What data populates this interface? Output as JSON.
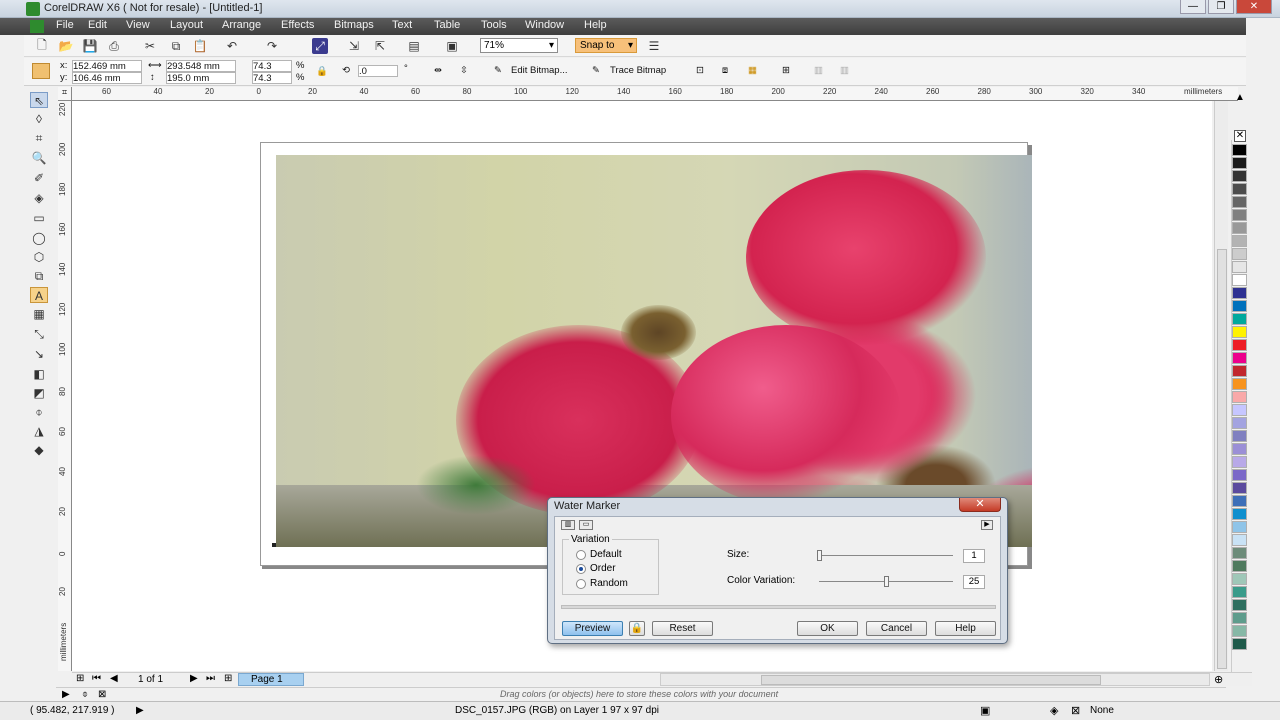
{
  "window": {
    "title": "CorelDRAW X6 ( Not for resale) - [Untitled-1]"
  },
  "menu": [
    "File",
    "Edit",
    "View",
    "Layout",
    "Arrange",
    "Effects",
    "Bitmaps",
    "Text",
    "Table",
    "Tools",
    "Window",
    "Help"
  ],
  "toolbar": {
    "zoom": "71%",
    "snap": "Snap to"
  },
  "props": {
    "x": "152.469 mm",
    "y": "106.46 mm",
    "w": "293.548 mm",
    "h": "195.0 mm",
    "sx": "74.3",
    "sy": "74.3",
    "pct": "%",
    "angle": ".0",
    "deg": "°",
    "edit_bitmap": "Edit Bitmap...",
    "trace_bitmap": "Trace Bitmap"
  },
  "ruler": {
    "top_ticks": [
      "60",
      "40",
      "20",
      "0",
      "20",
      "40",
      "60",
      "80",
      "100",
      "120",
      "140",
      "160",
      "180",
      "200",
      "220",
      "240",
      "260",
      "280",
      "300",
      "320",
      "340"
    ],
    "unit": "millimeters",
    "left_ticks": [
      "220",
      "200",
      "180",
      "160",
      "140",
      "120",
      "100",
      "80",
      "60",
      "40",
      "20",
      "0",
      "20"
    ],
    "left_unit": "millimeters"
  },
  "dialog": {
    "title": "Water Marker",
    "close": "✕",
    "variation_label": "Variation",
    "options": [
      "Default",
      "Order",
      "Random"
    ],
    "selected": "Order",
    "size_label": "Size:",
    "size_value": "1",
    "size_level": 0,
    "cv_label": "Color Variation:",
    "cv_value": "25",
    "cv_level": 0.5,
    "preview": "Preview",
    "reset": "Reset",
    "ok": "OK",
    "cancel": "Cancel",
    "help": "Help"
  },
  "pagebar": {
    "page_count": "1 of 1",
    "page_tab": "Page 1"
  },
  "colorbar": {
    "hint": "Drag colors (or objects) here to store these colors with your document"
  },
  "status": {
    "coords": "( 95.482, 217.919 )",
    "info": "DSC_0157.JPG (RGB) on Layer 1 97 x 97 dpi",
    "fill": "None"
  },
  "palette": [
    "#000000",
    "#1a1a1a",
    "#333333",
    "#4d4d4d",
    "#666666",
    "#808080",
    "#999999",
    "#b3b3b3",
    "#cccccc",
    "#e6e6e6",
    "#ffffff",
    "#2e3192",
    "#0071bc",
    "#00a99d",
    "#fff200",
    "#ed1c24",
    "#ec008c",
    "#c1272d",
    "#f7931e",
    "#f9a9a9",
    "#c6c6ff",
    "#a3a3e0",
    "#8080c0",
    "#9b8fd6",
    "#b8a9e8",
    "#7b68c8",
    "#5b4a9e",
    "#3d6fb8",
    "#0f8fce",
    "#8fc4e8",
    "#c9e2f5",
    "#6d8c7a",
    "#4f7a5e",
    "#9fc7b8",
    "#3a9b8a",
    "#2e6f5f",
    "#5e9c8c",
    "#86b8a6",
    "#1f5a4a"
  ]
}
